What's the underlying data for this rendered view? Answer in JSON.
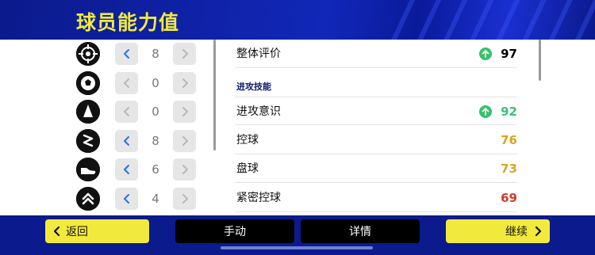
{
  "header": {
    "title": "球员能力值"
  },
  "skills": [
    {
      "icon": "target-icon",
      "value": "8",
      "prev_active": true
    },
    {
      "icon": "soccer-ball-icon",
      "value": "0",
      "prev_active": false
    },
    {
      "icon": "cone-icon",
      "value": "0",
      "prev_active": false
    },
    {
      "icon": "dribble-zigzag-icon",
      "value": "8",
      "prev_active": true
    },
    {
      "icon": "boot-icon",
      "value": "6",
      "prev_active": true
    },
    {
      "icon": "double-chevron-up-icon",
      "value": "4",
      "prev_active": true
    }
  ],
  "attributes": {
    "overall": {
      "label": "整体评价",
      "value": "97",
      "boosted": true,
      "color": "#111111"
    },
    "section_attack": "进攻技能",
    "items": [
      {
        "label": "进攻意识",
        "value": "92",
        "boosted": true,
        "color": "#3dbf7a"
      },
      {
        "label": "控球",
        "value": "76",
        "boosted": false,
        "color": "#d9a520"
      },
      {
        "label": "盘球",
        "value": "73",
        "boosted": false,
        "color": "#d9a520"
      },
      {
        "label": "紧密控球",
        "value": "69",
        "boosted": false,
        "color": "#d23a2a"
      }
    ]
  },
  "footer": {
    "back": "返回",
    "manual": "手动",
    "detail": "详情",
    "continue": "继续"
  },
  "colors": {
    "accent_yellow": "#f1ea3c",
    "navy": "#0b1a8c",
    "active_arrow": "#2a6fe0",
    "inactive_arrow": "#b8b8b8"
  }
}
